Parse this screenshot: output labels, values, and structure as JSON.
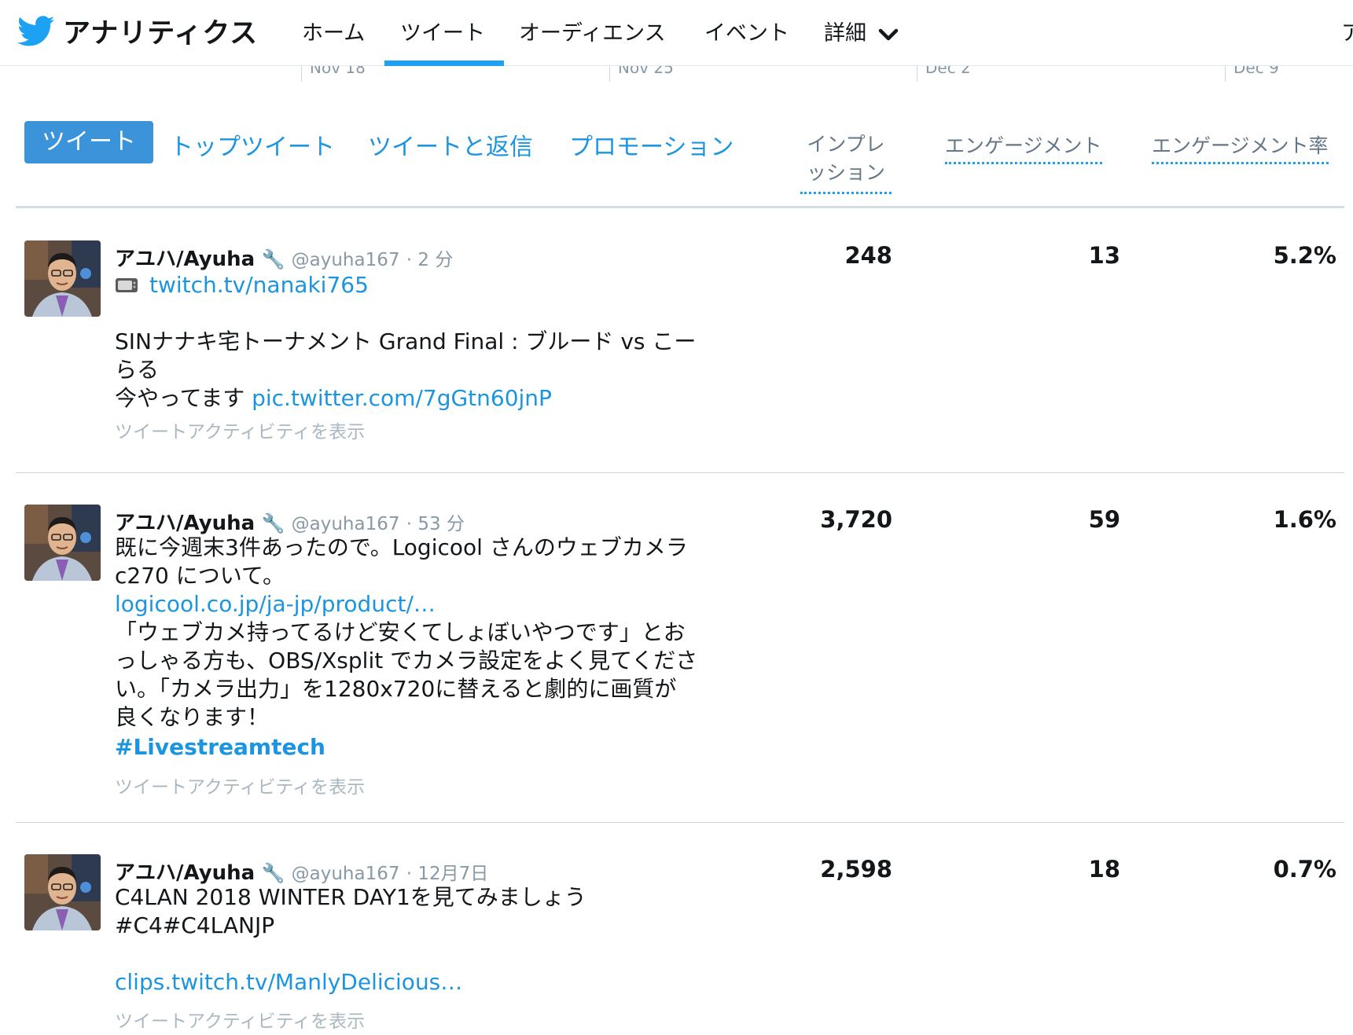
{
  "nav": {
    "brand": "アナリティクス",
    "items": [
      "ホーム",
      "ツイート",
      "オーディエンス",
      "イベント",
      "詳細"
    ],
    "cut_item": "ア"
  },
  "dates": [
    "Nov 18",
    "Nov 25",
    "Dec 2",
    "Dec 9"
  ],
  "tabs": [
    "ツイート",
    "トップツイート",
    "ツイートと返信",
    "プロモーション"
  ],
  "columns": {
    "impressions_line1": "インプレ",
    "impressions_line2": "ッション",
    "engagements": "エンゲージメント",
    "engagement_rate": "エンゲージメント率"
  },
  "colors": {
    "accent": "#1da1f2",
    "link": "#1b95e0",
    "active_tab": "#3b94d9"
  },
  "tweets": [
    {
      "name": "アユハ/Ayuha",
      "handle": "@ayuha167",
      "time": "· 2 分",
      "line_link": "twitch.tv/nanaki765",
      "text1": "SINナナキ宅トーナメント Grand Final : ブルード vs こー",
      "text2": "らる",
      "text3": "今やってます ",
      "link2": "pic.twitter.com/7gGtn60jnP",
      "activity": "ツイートアクティビティを表示",
      "impressions": "248",
      "engagements": "13",
      "rate": "5.2%"
    },
    {
      "name": "アユハ/Ayuha",
      "handle": "@ayuha167",
      "time": "· 53 分",
      "text1": "既に今週末3件あったので。Logicool さんのウェブカメラ",
      "text2": "c270 について。",
      "link": "logicool.co.jp/ja-jp/product/…",
      "text3": "「ウェブカメ持ってるけど安くてしょぼいやつです」とお",
      "text4": "っしゃる方も、OBS/Xsplit でカメラ設定をよく見てくださ",
      "text5": "い。「カメラ出力」を1280x720に替えると劇的に画質が",
      "text6": "良くなります！",
      "hashtag": "#Livestreamtech",
      "activity": "ツイートアクティビティを表示",
      "impressions": "3,720",
      "engagements": "59",
      "rate": "1.6%"
    },
    {
      "name": "アユハ/Ayuha",
      "handle": "@ayuha167",
      "time": "· 12月7日",
      "text1": "C4LAN 2018 WINTER DAY1を見てみましょう",
      "text2": "#C4#C4LANJP",
      "link": "clips.twitch.tv/ManlyDelicious…",
      "activity": "ツイートアクティビティを表示",
      "impressions": "2,598",
      "engagements": "18",
      "rate": "0.7%"
    }
  ]
}
